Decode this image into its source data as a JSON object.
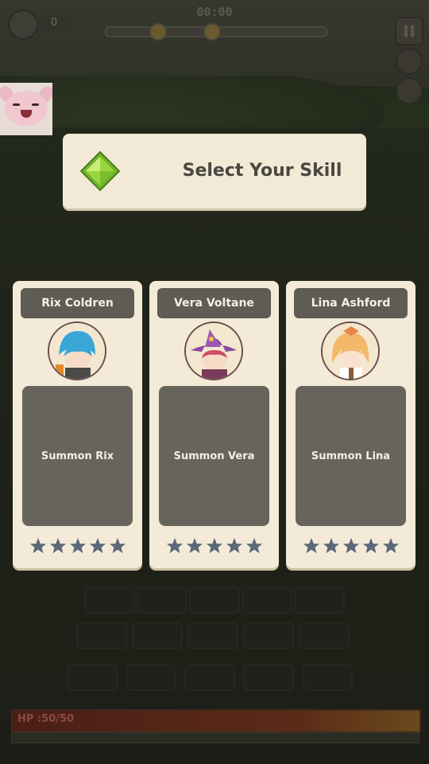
{
  "hud": {
    "timer": "00:00",
    "coin_count": "0",
    "icons": [
      "skull-icon",
      "pause-icon",
      "speed-icon",
      "auto-icon"
    ]
  },
  "overlay": {
    "title": "Select Your Skill",
    "title_icon": "green-gem-icon"
  },
  "cards": [
    {
      "name": "Rix Coldren",
      "description": "Summon Rix",
      "stars": 5,
      "portrait": "blue-haired-hero",
      "portrait_color": "#3aa6d8"
    },
    {
      "name": "Vera Voltane",
      "description": "Summon Vera",
      "stars": 5,
      "portrait": "purple-hat-witch",
      "portrait_color": "#8a4aa0"
    },
    {
      "name": "Lina Ashford",
      "description": "Summon Lina",
      "stars": 5,
      "portrait": "blonde-girl",
      "portrait_color": "#f3b86a"
    }
  ],
  "player": {
    "hp_label": "HP :50/50",
    "hp_current": 50,
    "hp_max": 50
  },
  "colors": {
    "banner_bg": "#f2ead6",
    "card_bg": "#f3ead7",
    "name_plate": "#5f5c55",
    "star": "#5b6878",
    "gem": "#8fd13a"
  }
}
